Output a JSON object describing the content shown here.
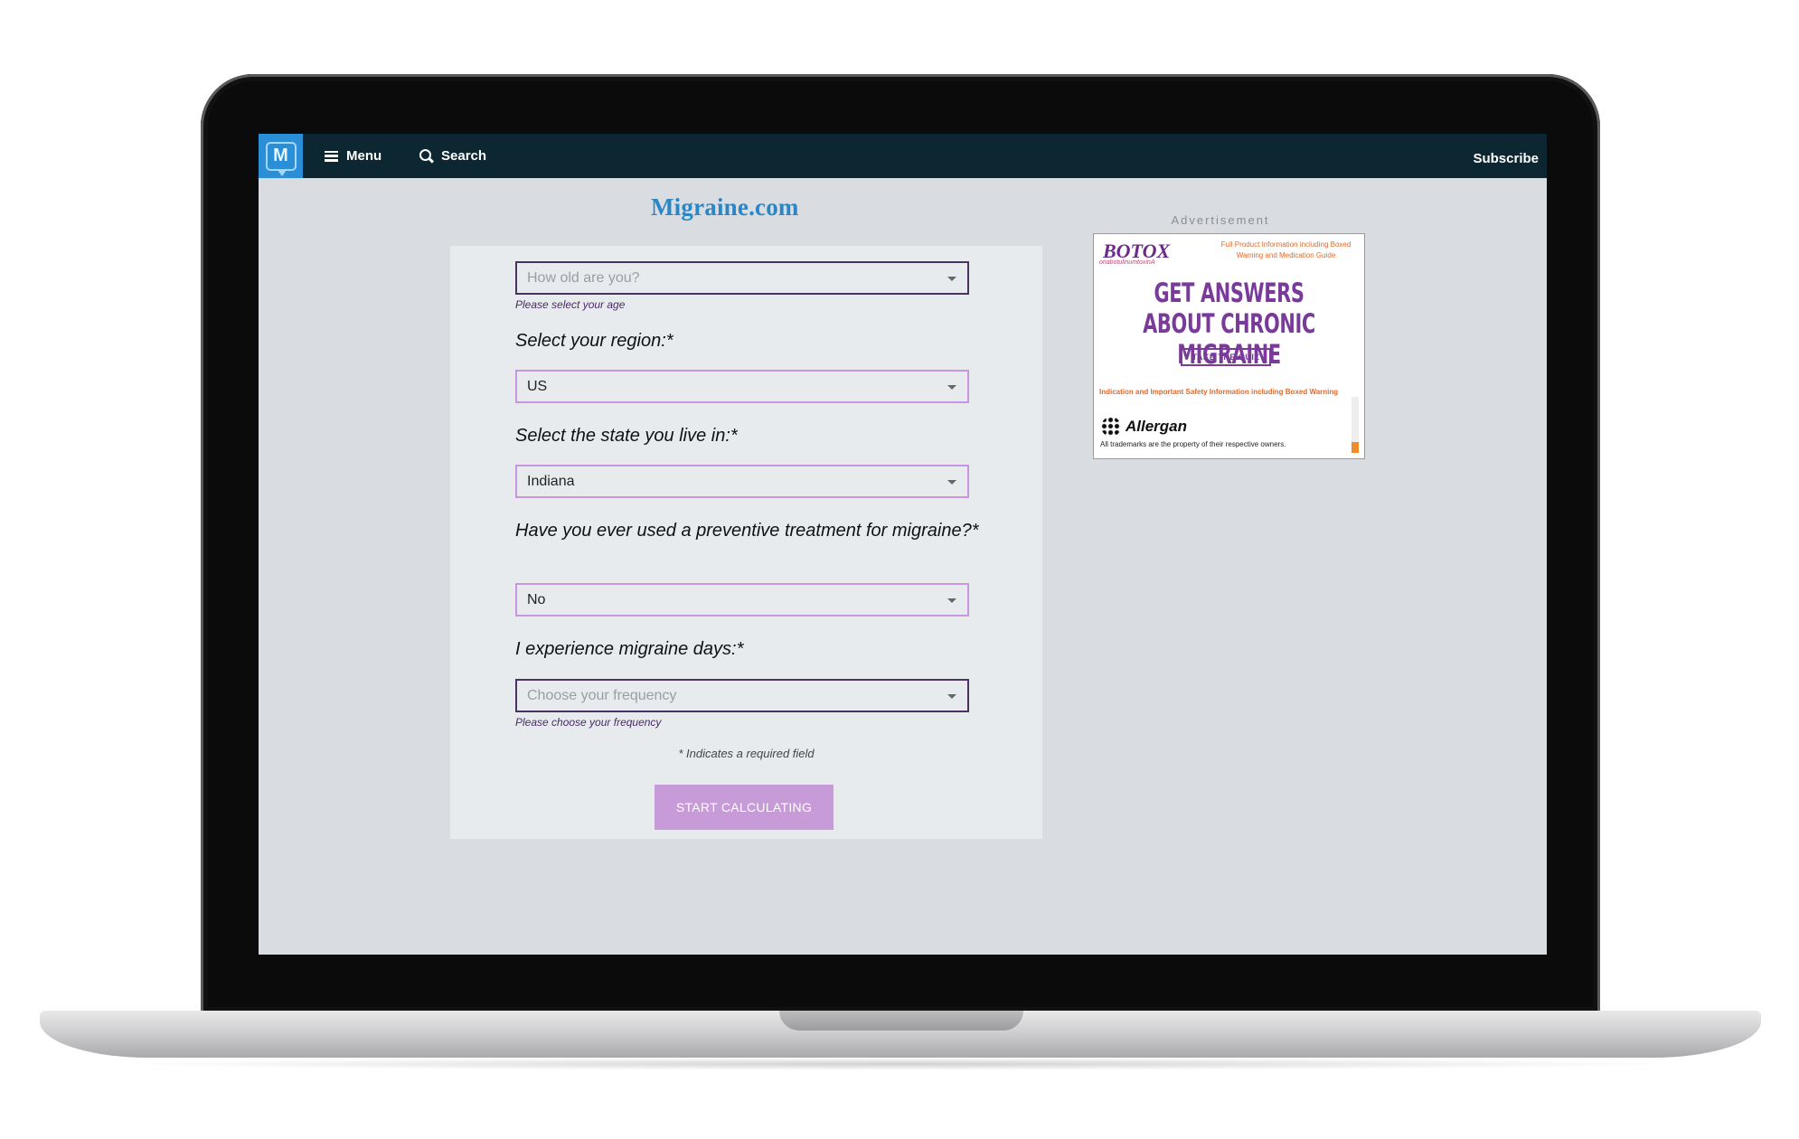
{
  "nav": {
    "logo_letter": "M",
    "menu_label": "Menu",
    "search_label": "Search",
    "subscribe_label": "Subscribe"
  },
  "site": {
    "title": "Migraine.com"
  },
  "form": {
    "age": {
      "placeholder": "How old are you?",
      "error": "Please select your age"
    },
    "region": {
      "label": "Select your region:*",
      "value": "US"
    },
    "state": {
      "label": "Select the state you live in:*",
      "value": "Indiana"
    },
    "preventive": {
      "label": "Have you ever used a preventive treatment for migraine?*",
      "value": "No"
    },
    "frequency": {
      "label": "I experience migraine days:*",
      "placeholder": "Choose your frequency",
      "error": "Please choose your frequency"
    },
    "required_note": "* Indicates a required field",
    "submit_label": "START CALCULATING"
  },
  "ad": {
    "label": "Advertisement",
    "brand": "BOTOX",
    "brand_sub": "onabotulinumtoxinA",
    "top_links": "Full Product Information including Boxed Warning and Medication Guide",
    "headline": "GET ANSWERS ABOUT CHRONIC MIGRAINE",
    "cta": "TAKE THE QUIZ",
    "isi": "Indication and Important Safety Information including Boxed Warning",
    "company": "Allergan",
    "trademark": "All trademarks are the property of their respective owners."
  },
  "colors": {
    "nav_bg": "#0c2731",
    "logo_bg": "#2a8fd6",
    "title_blue": "#2b86c5",
    "error_border": "#4a3263",
    "valid_border": "#c895e0",
    "button_bg": "#c79ad8",
    "ad_purple": "#7a3a9a",
    "ad_orange": "#e06a2a"
  }
}
